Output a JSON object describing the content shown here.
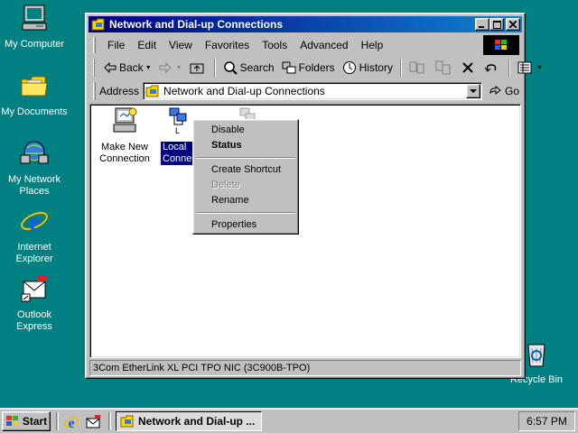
{
  "desktop": {
    "icons": [
      {
        "label": "My Computer",
        "icon": "computer-icon"
      },
      {
        "label": "My Documents",
        "icon": "folder-icon"
      },
      {
        "label": "My Network Places",
        "icon": "network-icon"
      },
      {
        "label": "Internet Explorer",
        "icon": "ie-icon"
      },
      {
        "label": "Outlook Express",
        "icon": "mail-icon"
      },
      {
        "label": "Recycle Bin",
        "icon": "recycle-bin-icon"
      }
    ]
  },
  "window": {
    "title": "Network and Dial-up Connections",
    "menu": [
      "File",
      "Edit",
      "View",
      "Favorites",
      "Tools",
      "Advanced",
      "Help"
    ],
    "toolbar": {
      "back": "Back",
      "search": "Search",
      "folders": "Folders",
      "history": "History"
    },
    "address": {
      "label": "Address",
      "value": "Network and Dial-up Connections",
      "go": "Go"
    },
    "items": [
      {
        "label": "Make New Connection",
        "icon": "make-connection-icon",
        "selected": false
      },
      {
        "label": "Local Conne",
        "icon": "lan-connection-icon",
        "selected": true
      },
      {
        "label": "",
        "icon": "connection-icon",
        "selected": false
      }
    ],
    "status": "3Com EtherLink XL PCI TPO NIC (3C900B-TPO)"
  },
  "context_menu": {
    "items": [
      {
        "label": "Disable",
        "style": "normal"
      },
      {
        "label": "Status",
        "style": "bold"
      },
      {
        "label": "Create Shortcut",
        "style": "normal"
      },
      {
        "label": "Delete",
        "style": "disabled"
      },
      {
        "label": "Rename",
        "style": "normal"
      },
      {
        "label": "Properties",
        "style": "normal"
      }
    ]
  },
  "taskbar": {
    "start": "Start",
    "task": "Network and Dial-up ...",
    "clock": "6:57 PM"
  },
  "colors": {
    "desktop": "#008080",
    "title_active": "#000080",
    "selection": "#000080"
  }
}
